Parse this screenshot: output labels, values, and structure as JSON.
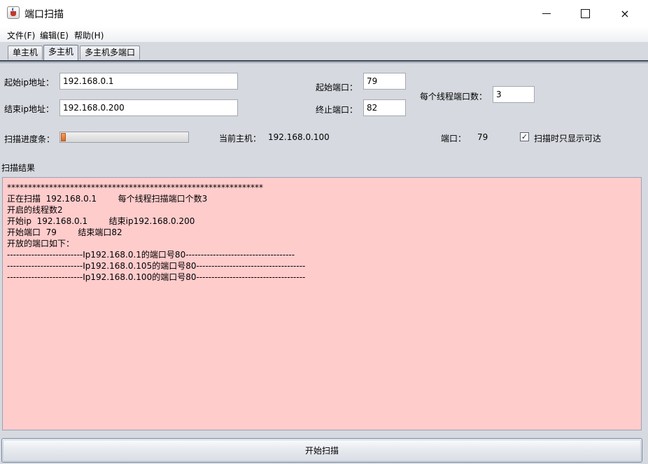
{
  "window": {
    "title": "端口扫描",
    "icon": "java-cup-icon",
    "controls": {
      "minimize": "minimize-icon",
      "maximize": "maximize-icon",
      "close": "×"
    }
  },
  "menu": {
    "items": [
      {
        "label": "文件(F)"
      },
      {
        "label": "编辑(E)"
      },
      {
        "label": "帮助(H)"
      }
    ]
  },
  "tabs": [
    {
      "label": "单主机",
      "active": false
    },
    {
      "label": "多主机",
      "active": true
    },
    {
      "label": "多主机多端口",
      "active": false
    }
  ],
  "form": {
    "start_ip_label": "起始ip地址：",
    "start_ip_value": "192.168.0.1",
    "end_ip_label": "结束ip地址：",
    "end_ip_value": "192.168.0.200",
    "start_port_label": "起始端口：",
    "start_port_value": "79",
    "end_port_label": "终止端口：",
    "end_port_value": "82",
    "threads_label": "每个线程端口数：",
    "threads_value": "3",
    "progress_label": "扫描进度条：",
    "progress_fraction": 0.04,
    "current_host_label": "当前主机：",
    "current_host_value": "192.168.0.100",
    "port_label": "端口：",
    "port_value": "79",
    "show_reachable_checked": true,
    "show_reachable_label": "扫描时只显示可达"
  },
  "results": {
    "title": "扫描结果",
    "background": "#ffcccc",
    "lines": [
      "*************************************************************",
      "正在扫描  192.168.0.1        每个线程扫描端口个数3",
      "开启的线程数2",
      "开始ip  192.168.0.1        结束ip192.168.0.200",
      "开始端口  79        结束端口82",
      "开放的端口如下：",
      "-------------------------Ip192.168.0.1的端口号80------------------------------------",
      "-------------------------Ip192.168.0.105的端口号80------------------------------------",
      "-------------------------Ip192.168.0.100的端口号80------------------------------------"
    ]
  },
  "actions": {
    "start_scan_label": "开始扫描"
  }
}
